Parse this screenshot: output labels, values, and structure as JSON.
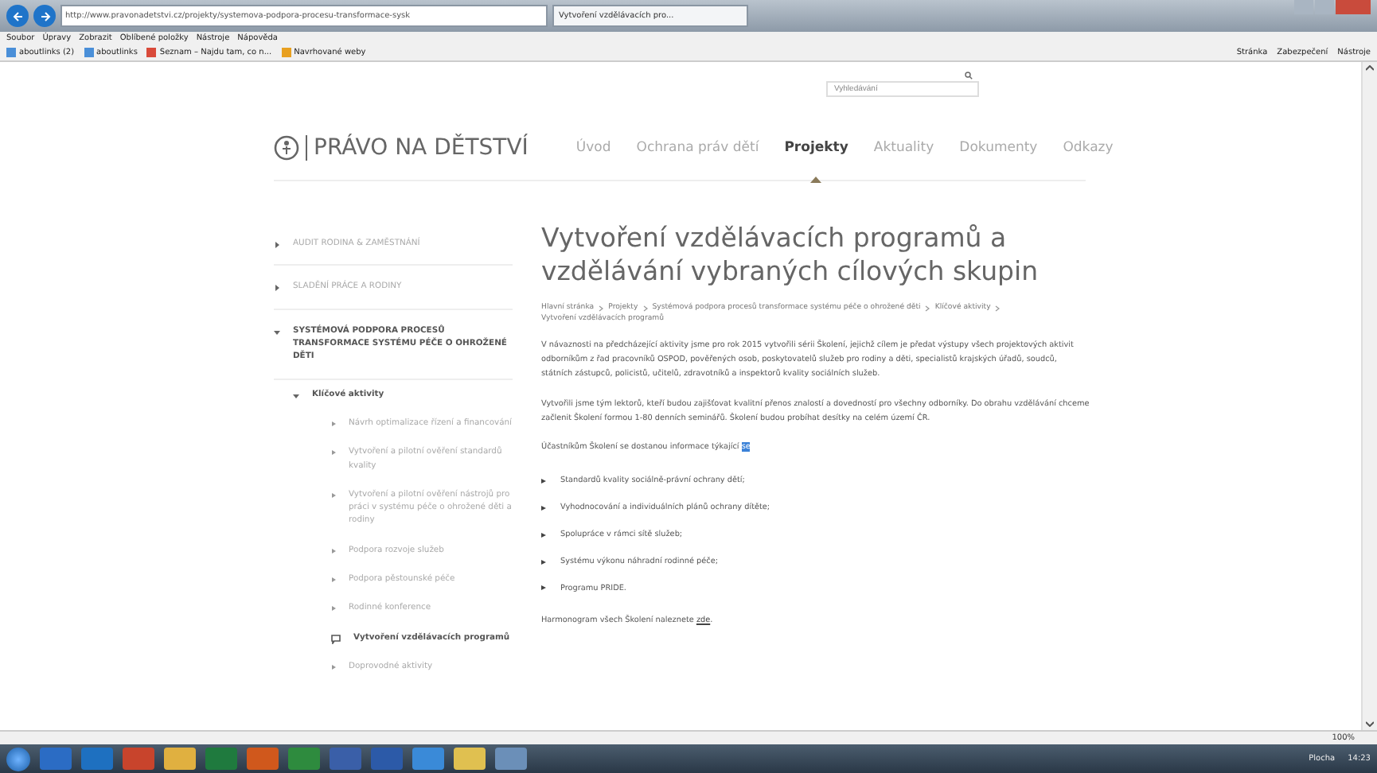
{
  "browser": {
    "address": "http://www.pravonadetstvi.cz/projekty/systemova-podpora-procesu-transformace-sysk",
    "tab": "Vytvoření vzdělávacích pro...",
    "menu": [
      "Soubor",
      "Úpravy",
      "Zobrazit",
      "Oblíbené položky",
      "Nástroje",
      "Nápověda"
    ],
    "favorites": [
      "aboutlinks (2)",
      "aboutlinks",
      "Seznam – Najdu tam, co n...",
      "Navrhované weby"
    ],
    "commands": [
      "Stránka",
      "Zabezpečení",
      "Nástroje"
    ]
  },
  "search": {
    "placeholder": "Vyhledávání"
  },
  "site": {
    "logo": "PRÁVO NA DĚTSTVÍ",
    "nav": [
      {
        "label": "Úvod",
        "selected": false
      },
      {
        "label": "Ochrana práv dětí",
        "selected": false
      },
      {
        "label": "Projekty",
        "selected": true
      },
      {
        "label": "Aktuality",
        "selected": false
      },
      {
        "label": "Dokumenty",
        "selected": false
      },
      {
        "label": "Odkazy",
        "selected": false
      }
    ]
  },
  "sidebar": [
    {
      "label": "AUDIT RODINA & ZAMĚSTNÁNÍ",
      "expanded": false
    },
    {
      "label": "SLADĚNÍ PRÁCE A RODINY",
      "expanded": false
    },
    {
      "label": "SYSTÉMOVÁ PODPORA PROCESŮ TRANSFORMACE SYSTÉMU PÉČE O OHROŽENÉ DĚTI",
      "expanded": true,
      "children": [
        {
          "label": "Klíčové aktivity",
          "expanded": true,
          "children": [
            {
              "label": "Návrh optimalizace řízení a financování",
              "selected": false
            },
            {
              "label": "Vytvoření a pilotní ověření standardů kvality",
              "selected": false
            },
            {
              "label": "Vytvoření a pilotní ověření nástrojů pro práci v systému péče o ohrožené děti a rodiny",
              "selected": false
            },
            {
              "label": "Podpora rozvoje služeb",
              "selected": false
            },
            {
              "label": "Podpora pěstounské péče",
              "selected": false
            },
            {
              "label": "Rodinné konference",
              "selected": false
            },
            {
              "label": "Vytvoření vzdělávacích programů",
              "selected": true
            },
            {
              "label": "Doprovodné aktivity",
              "selected": false
            }
          ]
        }
      ]
    }
  ],
  "article": {
    "title": "Vytvoření vzdělávacích programů a vzdělávání vybraných cílových skupin",
    "breadcrumb": [
      "Hlavní stránka",
      "Projekty",
      "Systémová podpora procesů transformace systému péče o ohrožené děti",
      "Klíčové aktivity",
      "Vytvoření vzdělávacích programů"
    ],
    "paragraphs": [
      "V návaznosti na předcházející aktivity jsme pro rok 2015 vytvořili sérii Školení, jejichž cílem je předat výstupy všech projektových aktivit odborníkům z řad pracovníků OSPOD, pověřených osob, poskytovatelů služeb pro rodiny a děti, specialistů krajských úřadů, soudců, státních zástupců, policistů, učitelů, zdravotníků a inspektorů kvality sociálních služeb.",
      "Vytvořili jsme tým lektorů, kteří budou zajišťovat kvalitní přenos znalostí a dovedností pro všechny odborníky. Do obrahu vzdělávání chceme začlenit Školení formou 1-80 denních seminářů. Školení budou probíhat desítky na celém území ČR."
    ],
    "intro": "Účastníkům Školení se dostanou informace týkající",
    "highlight": "se",
    "bullets": [
      "Standardů kvality sociálně-právní ochrany dětí;",
      "Vyhodnocování a individuálních plánů ochrany dítěte;",
      "Spolupráce v rámci sítě služeb;",
      "Systému výkonu náhradní rodinné péče;",
      "Programu PRIDE."
    ],
    "closing": "Harmonogram všech Školení naleznete",
    "link": "zde",
    "closing_end": "."
  },
  "status": {
    "zoom": "100%"
  },
  "taskbar": {
    "tray": "Plocha",
    "time": "14:23"
  }
}
